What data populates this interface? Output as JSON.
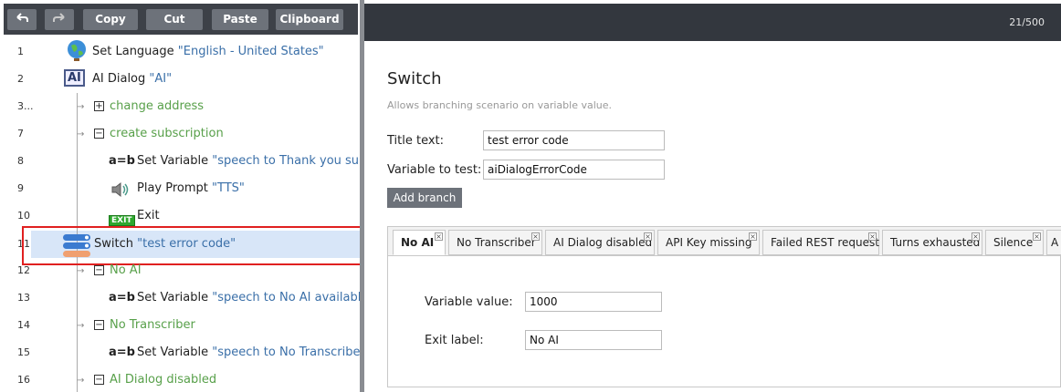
{
  "toolbar": {
    "copy": "Copy",
    "cut": "Cut",
    "paste": "Paste",
    "clipboard": "Clipboard"
  },
  "tree": [
    {
      "ln": "1",
      "label": "Set Language",
      "value": "\"English - United States\""
    },
    {
      "ln": "2",
      "label": "AI Dialog",
      "value": "\"AI\""
    },
    {
      "ln": "3...",
      "label": "change address"
    },
    {
      "ln": "7",
      "label": "create subscription"
    },
    {
      "ln": "8",
      "label": "Set Variable",
      "value": "\"speech to Thank you subsc"
    },
    {
      "ln": "9",
      "label": "Play Prompt",
      "value": "\"TTS\""
    },
    {
      "ln": "10",
      "label": "Exit"
    },
    {
      "ln": "11",
      "label": "Switch",
      "value": "\"test error code\""
    },
    {
      "ln": "12",
      "label": "No AI"
    },
    {
      "ln": "13",
      "label": "Set Variable",
      "value": "\"speech to No AI available!\""
    },
    {
      "ln": "14",
      "label": "No Transcriber"
    },
    {
      "ln": "15",
      "label": "Set Variable",
      "value": "\"speech to No Transcriber a"
    },
    {
      "ln": "16",
      "label": "AI Dialog disabled"
    }
  ],
  "icons": {
    "ai": "AI",
    "exit": "EXIT",
    "setvar": "a=b"
  },
  "counter": "21/500",
  "panel": {
    "title": "Switch",
    "description": "Allows branching scenario on variable value.",
    "title_label": "Title text:",
    "title_value": "test error code",
    "variable_label": "Variable to test:",
    "variable_value": "aiDialogErrorCode",
    "add_branch": "Add branch"
  },
  "tabs": [
    "No AI",
    "No Transcriber",
    "AI Dialog disabled",
    "API Key missing",
    "Failed REST request",
    "Turns exhausted",
    "Silence",
    "A"
  ],
  "branch": {
    "value_label": "Variable value:",
    "value": "1000",
    "exit_label": "Exit label:",
    "exit_value": "No AI"
  }
}
